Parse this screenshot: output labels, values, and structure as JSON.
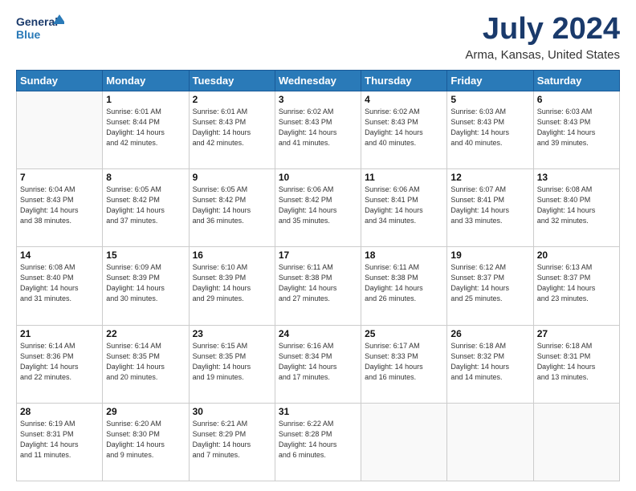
{
  "header": {
    "logo_line1": "General",
    "logo_line2": "Blue",
    "title": "July 2024",
    "subtitle": "Arma, Kansas, United States"
  },
  "days_of_week": [
    "Sunday",
    "Monday",
    "Tuesday",
    "Wednesday",
    "Thursday",
    "Friday",
    "Saturday"
  ],
  "weeks": [
    [
      {
        "day": "",
        "info": ""
      },
      {
        "day": "1",
        "info": "Sunrise: 6:01 AM\nSunset: 8:44 PM\nDaylight: 14 hours\nand 42 minutes."
      },
      {
        "day": "2",
        "info": "Sunrise: 6:01 AM\nSunset: 8:43 PM\nDaylight: 14 hours\nand 42 minutes."
      },
      {
        "day": "3",
        "info": "Sunrise: 6:02 AM\nSunset: 8:43 PM\nDaylight: 14 hours\nand 41 minutes."
      },
      {
        "day": "4",
        "info": "Sunrise: 6:02 AM\nSunset: 8:43 PM\nDaylight: 14 hours\nand 40 minutes."
      },
      {
        "day": "5",
        "info": "Sunrise: 6:03 AM\nSunset: 8:43 PM\nDaylight: 14 hours\nand 40 minutes."
      },
      {
        "day": "6",
        "info": "Sunrise: 6:03 AM\nSunset: 8:43 PM\nDaylight: 14 hours\nand 39 minutes."
      }
    ],
    [
      {
        "day": "7",
        "info": "Sunrise: 6:04 AM\nSunset: 8:43 PM\nDaylight: 14 hours\nand 38 minutes."
      },
      {
        "day": "8",
        "info": "Sunrise: 6:05 AM\nSunset: 8:42 PM\nDaylight: 14 hours\nand 37 minutes."
      },
      {
        "day": "9",
        "info": "Sunrise: 6:05 AM\nSunset: 8:42 PM\nDaylight: 14 hours\nand 36 minutes."
      },
      {
        "day": "10",
        "info": "Sunrise: 6:06 AM\nSunset: 8:42 PM\nDaylight: 14 hours\nand 35 minutes."
      },
      {
        "day": "11",
        "info": "Sunrise: 6:06 AM\nSunset: 8:41 PM\nDaylight: 14 hours\nand 34 minutes."
      },
      {
        "day": "12",
        "info": "Sunrise: 6:07 AM\nSunset: 8:41 PM\nDaylight: 14 hours\nand 33 minutes."
      },
      {
        "day": "13",
        "info": "Sunrise: 6:08 AM\nSunset: 8:40 PM\nDaylight: 14 hours\nand 32 minutes."
      }
    ],
    [
      {
        "day": "14",
        "info": "Sunrise: 6:08 AM\nSunset: 8:40 PM\nDaylight: 14 hours\nand 31 minutes."
      },
      {
        "day": "15",
        "info": "Sunrise: 6:09 AM\nSunset: 8:39 PM\nDaylight: 14 hours\nand 30 minutes."
      },
      {
        "day": "16",
        "info": "Sunrise: 6:10 AM\nSunset: 8:39 PM\nDaylight: 14 hours\nand 29 minutes."
      },
      {
        "day": "17",
        "info": "Sunrise: 6:11 AM\nSunset: 8:38 PM\nDaylight: 14 hours\nand 27 minutes."
      },
      {
        "day": "18",
        "info": "Sunrise: 6:11 AM\nSunset: 8:38 PM\nDaylight: 14 hours\nand 26 minutes."
      },
      {
        "day": "19",
        "info": "Sunrise: 6:12 AM\nSunset: 8:37 PM\nDaylight: 14 hours\nand 25 minutes."
      },
      {
        "day": "20",
        "info": "Sunrise: 6:13 AM\nSunset: 8:37 PM\nDaylight: 14 hours\nand 23 minutes."
      }
    ],
    [
      {
        "day": "21",
        "info": "Sunrise: 6:14 AM\nSunset: 8:36 PM\nDaylight: 14 hours\nand 22 minutes."
      },
      {
        "day": "22",
        "info": "Sunrise: 6:14 AM\nSunset: 8:35 PM\nDaylight: 14 hours\nand 20 minutes."
      },
      {
        "day": "23",
        "info": "Sunrise: 6:15 AM\nSunset: 8:35 PM\nDaylight: 14 hours\nand 19 minutes."
      },
      {
        "day": "24",
        "info": "Sunrise: 6:16 AM\nSunset: 8:34 PM\nDaylight: 14 hours\nand 17 minutes."
      },
      {
        "day": "25",
        "info": "Sunrise: 6:17 AM\nSunset: 8:33 PM\nDaylight: 14 hours\nand 16 minutes."
      },
      {
        "day": "26",
        "info": "Sunrise: 6:18 AM\nSunset: 8:32 PM\nDaylight: 14 hours\nand 14 minutes."
      },
      {
        "day": "27",
        "info": "Sunrise: 6:18 AM\nSunset: 8:31 PM\nDaylight: 14 hours\nand 13 minutes."
      }
    ],
    [
      {
        "day": "28",
        "info": "Sunrise: 6:19 AM\nSunset: 8:31 PM\nDaylight: 14 hours\nand 11 minutes."
      },
      {
        "day": "29",
        "info": "Sunrise: 6:20 AM\nSunset: 8:30 PM\nDaylight: 14 hours\nand 9 minutes."
      },
      {
        "day": "30",
        "info": "Sunrise: 6:21 AM\nSunset: 8:29 PM\nDaylight: 14 hours\nand 7 minutes."
      },
      {
        "day": "31",
        "info": "Sunrise: 6:22 AM\nSunset: 8:28 PM\nDaylight: 14 hours\nand 6 minutes."
      },
      {
        "day": "",
        "info": ""
      },
      {
        "day": "",
        "info": ""
      },
      {
        "day": "",
        "info": ""
      }
    ]
  ]
}
